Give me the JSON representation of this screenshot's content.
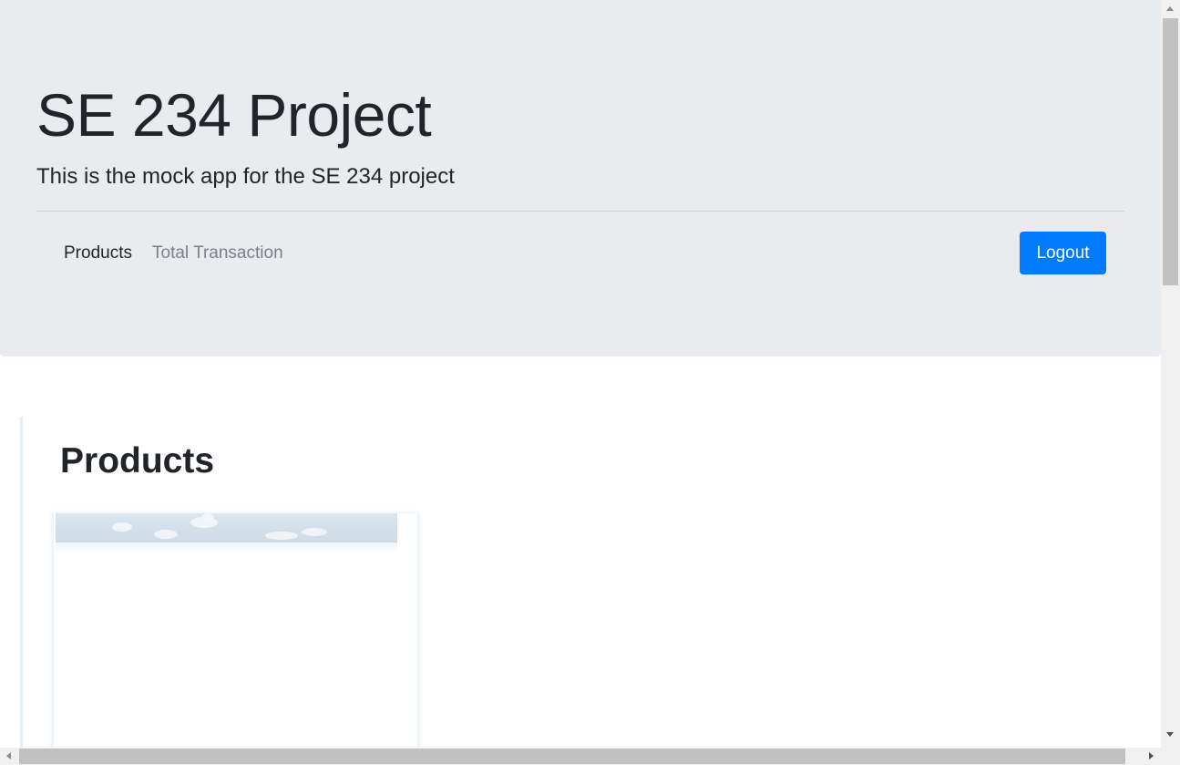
{
  "header": {
    "title": "SE 234 Project",
    "lead": "This is the mock app for the SE 234 project"
  },
  "nav": {
    "items": [
      {
        "label": "Products",
        "active": true
      },
      {
        "label": "Total Transaction",
        "active": false
      }
    ],
    "logout_label": "Logout"
  },
  "main": {
    "heading": "Products"
  },
  "colors": {
    "jumbotron_bg": "#e9ecef",
    "primary": "#007bff",
    "muted_link": "#7b8087"
  },
  "icons": {
    "scroll_up": "triangle-up",
    "scroll_down": "triangle-down",
    "scroll_left": "triangle-left",
    "scroll_right": "triangle-right"
  }
}
